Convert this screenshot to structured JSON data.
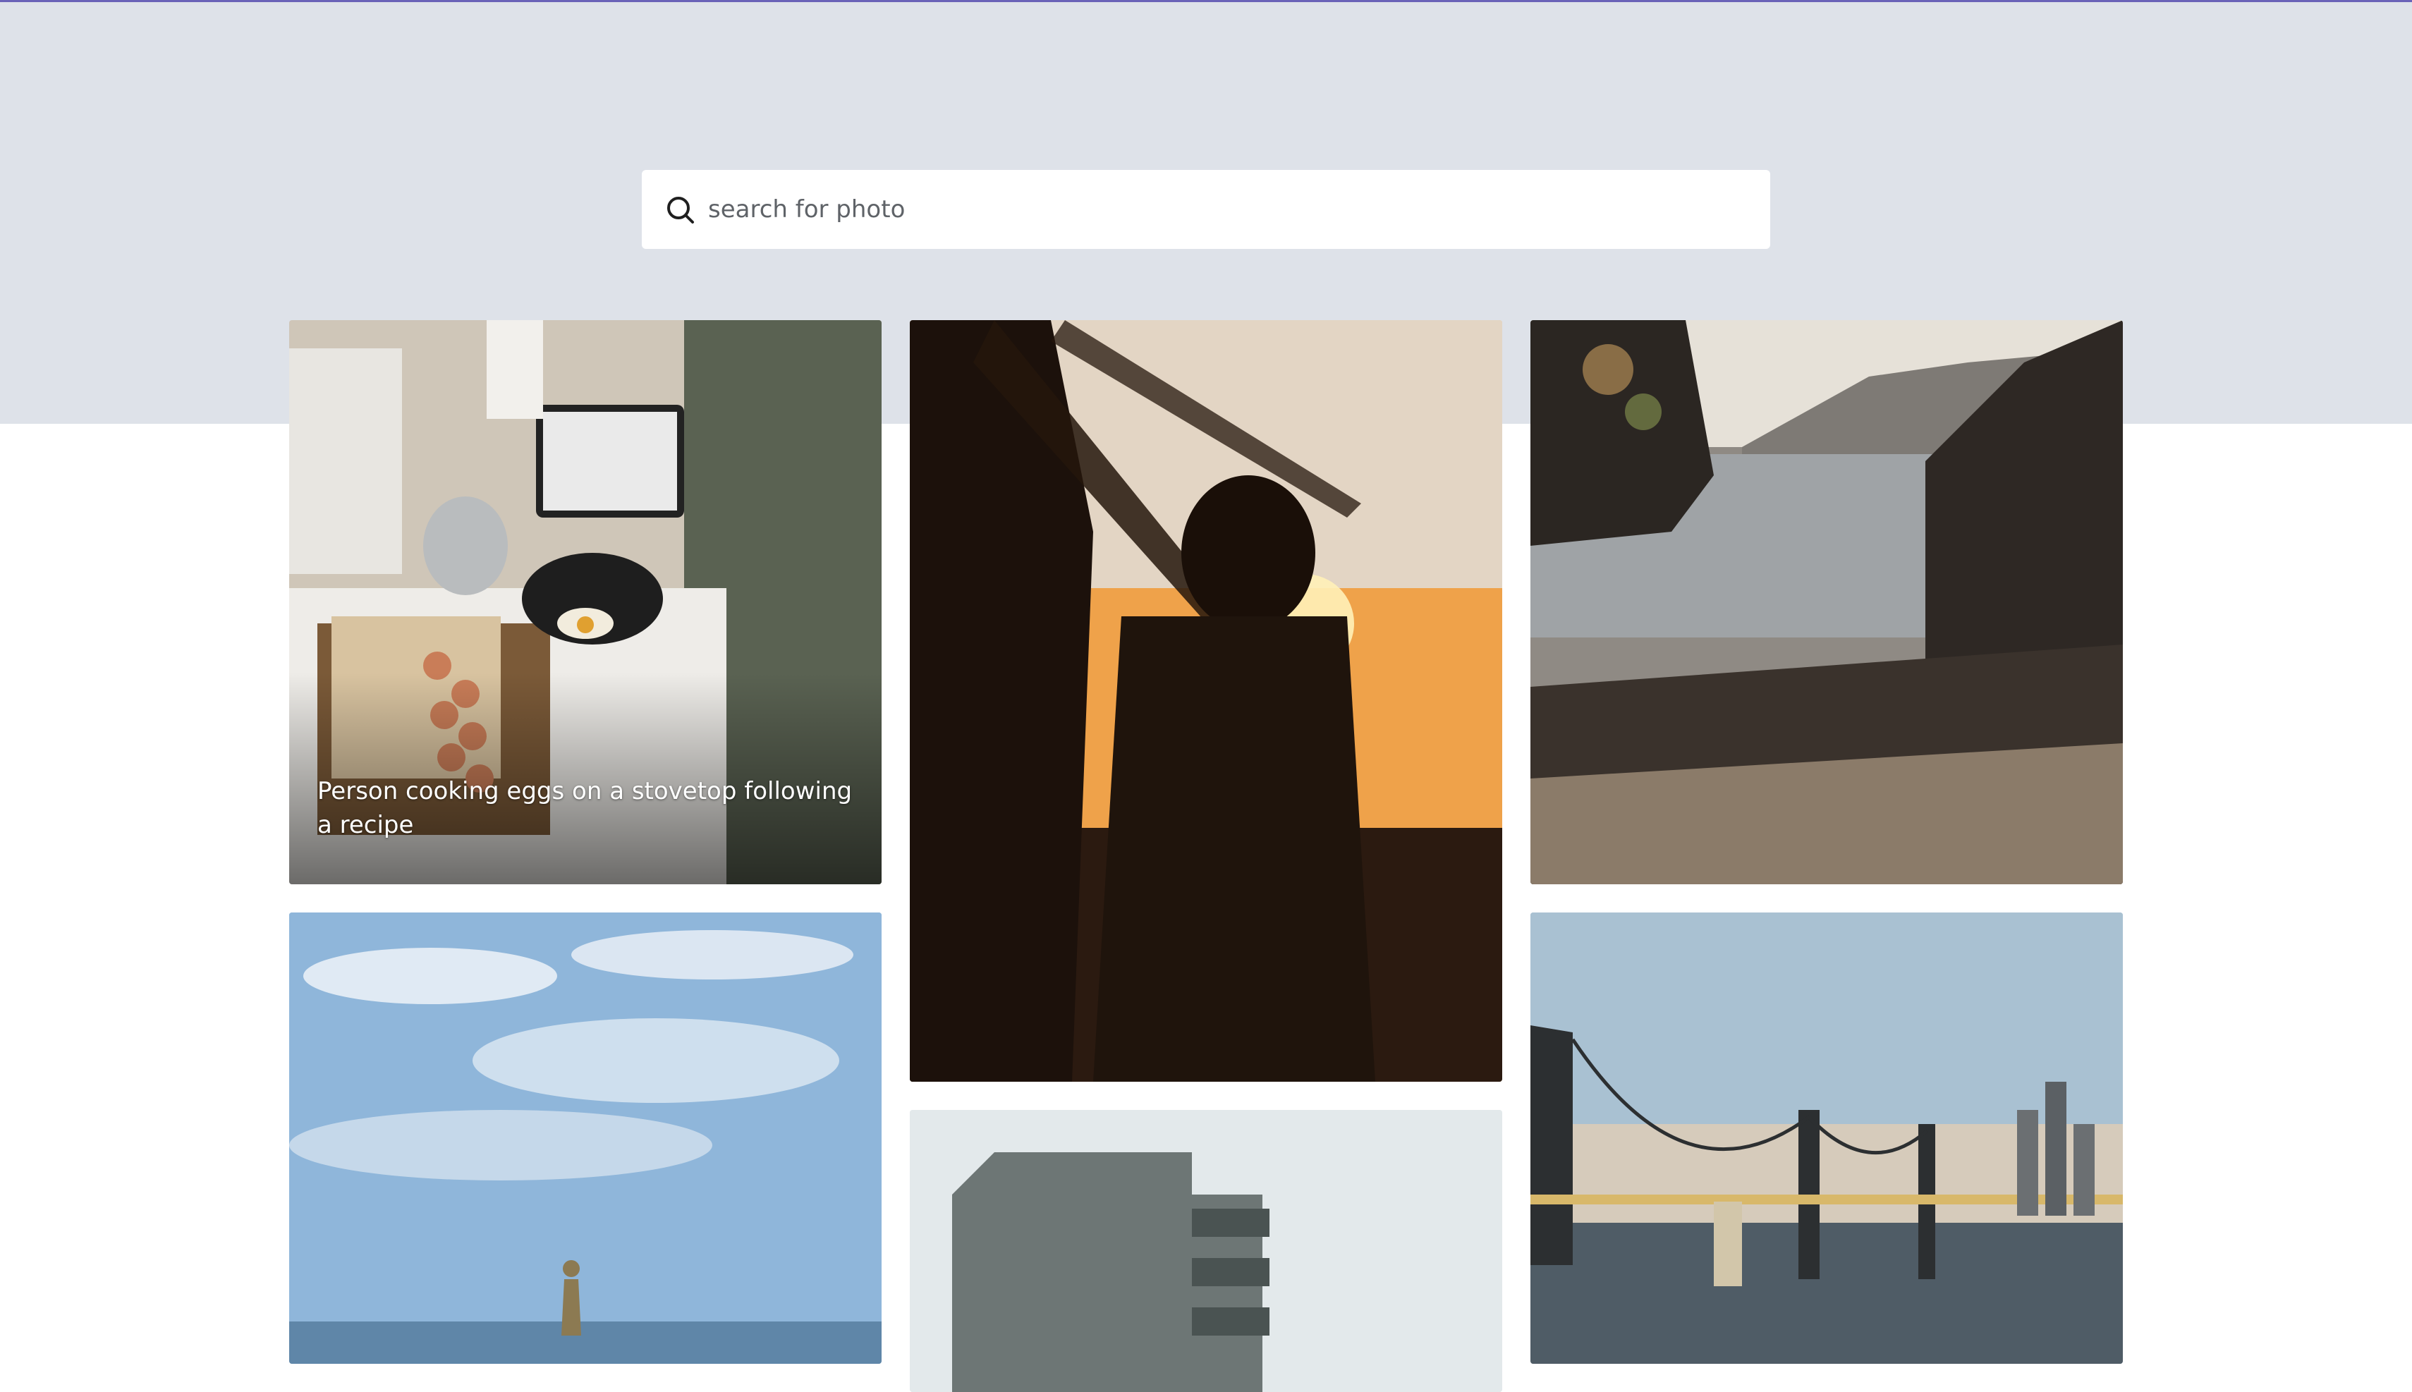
{
  "search": {
    "placeholder": "search for photo",
    "value": ""
  },
  "photos": [
    {
      "caption": "Person cooking eggs on a stovetop following a recipe"
    },
    {
      "caption": ""
    },
    {
      "caption": ""
    },
    {
      "caption": ""
    },
    {
      "caption": ""
    },
    {
      "caption": ""
    }
  ],
  "colors": {
    "hero_background": "#dee2e9",
    "top_accent_line": "#6a63b8",
    "page_background": "#ffffff",
    "search_background": "#ffffff"
  },
  "icons": {
    "search": "search-icon"
  }
}
